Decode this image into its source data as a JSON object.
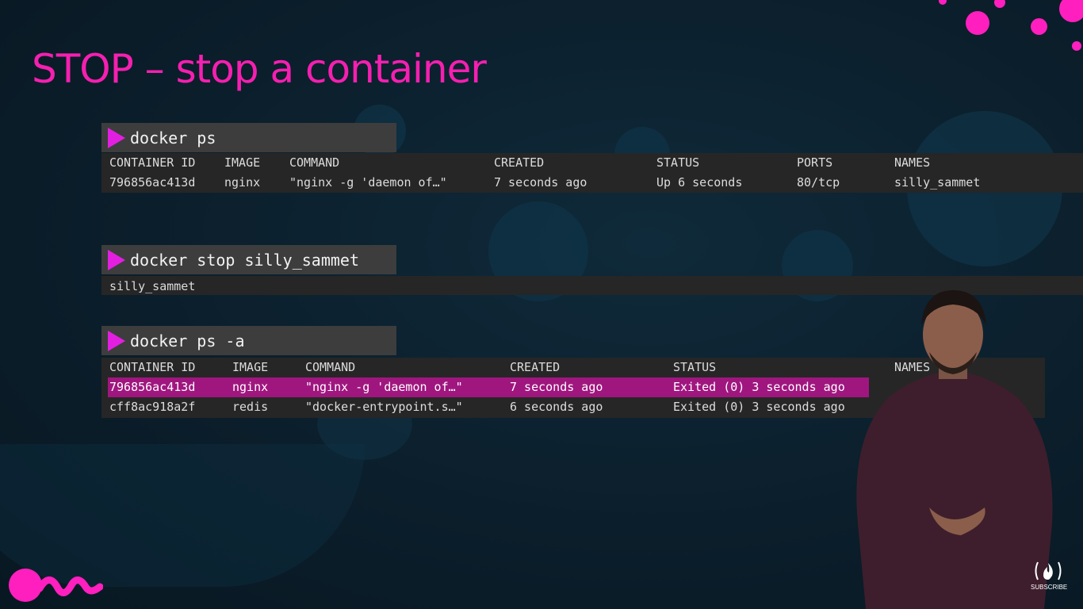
{
  "slide": {
    "title": "STOP – stop a container",
    "accent_color": "#f51fb0"
  },
  "commands": [
    {
      "command": "docker ps",
      "headers": [
        "CONTAINER ID",
        "IMAGE",
        "COMMAND",
        "CREATED",
        "STATUS",
        "PORTS",
        "NAMES"
      ],
      "rows": [
        [
          "796856ac413d",
          "nginx",
          "\"nginx -g 'daemon of…\"",
          "7 seconds ago",
          "Up 6 seconds",
          "80/tcp",
          "silly_sammet"
        ]
      ]
    },
    {
      "command": "docker stop silly_sammet",
      "output": "silly_sammet"
    },
    {
      "command": "docker ps -a",
      "headers": [
        "CONTAINER ID",
        "IMAGE",
        "COMMAND",
        "CREATED",
        "STATUS",
        "NAMES"
      ],
      "rows": [
        [
          "796856ac413d",
          "nginx",
          "\"nginx -g 'daemon of…\"",
          "7 seconds ago",
          "Exited (0) 3 seconds ago"
        ],
        [
          "cff8ac918a2f",
          "redis",
          "\"docker-entrypoint.s…\"",
          "6 seconds ago",
          "Exited (0) 3 seconds ago"
        ]
      ],
      "highlight_color": "#a0167f"
    }
  ],
  "subscribe_label": "SUBSCRIBE",
  "icons": [
    "play-arrow-icon",
    "freecodecamp-flame-icon",
    "brand-wave-logo"
  ]
}
